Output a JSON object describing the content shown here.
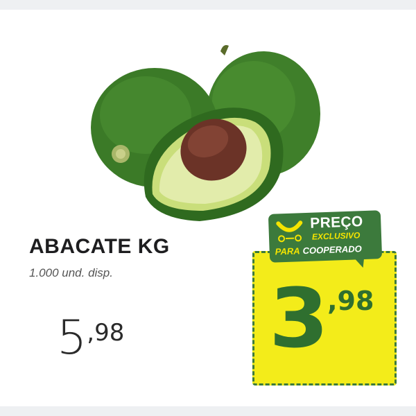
{
  "product": {
    "name": "ABACATE KG",
    "stock": "1.000 und. disp.",
    "image_icon": "avocado-image"
  },
  "price": {
    "regular_int": "5",
    "regular_dec": ",98",
    "promo_int": "3",
    "promo_dec": ",98"
  },
  "badge": {
    "line1": "PREÇO",
    "line2": "EXCLUSIVO",
    "line3a": "PARA",
    "line3b": "COOPERADO",
    "icon": "smile-logo-icon"
  },
  "colors": {
    "brand_green": "#3c7a3c",
    "promo_yellow": "#f3ec1a",
    "badge_text_yellow": "#f4e400",
    "text_dark": "#1d1d1f"
  }
}
